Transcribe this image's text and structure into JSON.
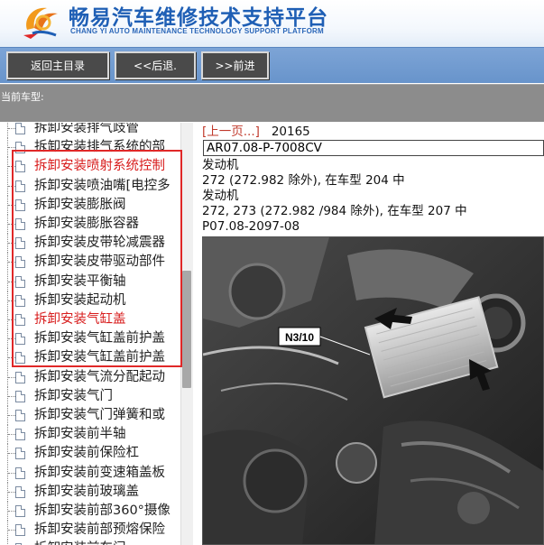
{
  "header": {
    "title": "畅易汽车维修技术支持平台",
    "subtitle": "CHANG YI AUTO MAINTENANCE TECHNOLOGY SUPPORT PLATFORM"
  },
  "toolbar": {
    "home_label": "返回主目录",
    "back_label": "<<后退.",
    "forward_label": ">>前进"
  },
  "cartype": {
    "label": "当前车型:"
  },
  "tree": {
    "items": [
      {
        "label": "拆卸安装排气歧管",
        "red": false
      },
      {
        "label": "拆卸安装排气系统的部",
        "red": false
      },
      {
        "label": "拆卸安装喷射系统控制",
        "red": true
      },
      {
        "label": "拆卸安装喷油嘴[电控多",
        "red": false
      },
      {
        "label": "拆卸安装膨胀阀",
        "red": false
      },
      {
        "label": "拆卸安装膨胀容器",
        "red": false
      },
      {
        "label": "拆卸安装皮带轮减震器",
        "red": false
      },
      {
        "label": "拆卸安装皮带驱动部件",
        "red": false
      },
      {
        "label": "拆卸安装平衡轴",
        "red": false
      },
      {
        "label": "拆卸安装起动机",
        "red": false
      },
      {
        "label": "拆卸安装气缸盖",
        "red": true
      },
      {
        "label": "拆卸安装气缸盖前护盖",
        "red": false
      },
      {
        "label": "拆卸安装气缸盖前护盖",
        "red": false
      },
      {
        "label": "拆卸安装气流分配起动",
        "red": false
      },
      {
        "label": "拆卸安装气门",
        "red": false
      },
      {
        "label": "拆卸安装气门弹簧和或",
        "red": false
      },
      {
        "label": "拆卸安装前半轴",
        "red": false
      },
      {
        "label": "拆卸安装前保险杠",
        "red": false
      },
      {
        "label": "拆卸安装前变速箱盖板",
        "red": false
      },
      {
        "label": "拆卸安装前玻璃盖",
        "red": false
      },
      {
        "label": "拆卸安装前部360°摄像",
        "red": false
      },
      {
        "label": "拆卸安装前部预熔保险",
        "red": false
      },
      {
        "label": "拆卸安装前车门",
        "red": false
      }
    ]
  },
  "content": {
    "prev_link": "[上一页...]",
    "page_number": "20165",
    "doc_code": "AR07.08-P-7008CV",
    "line1": "发动机",
    "line2": "272 (272.982 除外), 在车型 204 中",
    "line3": "发动机",
    "line4": "272, 273 (272.982 /984 除外), 在车型 207 中",
    "line5": "P07.08-2097-08",
    "photo_label": "N3/10"
  },
  "colors": {
    "brand_blue": "#1f5fb5",
    "toolbar_blue": "#6894cb",
    "button_dark": "#4a4a4a",
    "highlight_red": "#d81e1e",
    "annotation_red": "#e02828"
  }
}
